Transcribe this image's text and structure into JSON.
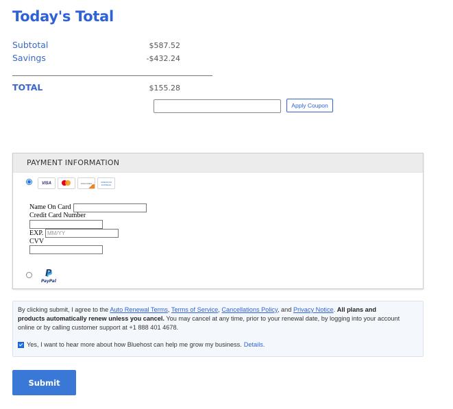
{
  "summary": {
    "title": "Today's Total",
    "subtotal_label": "Subtotal",
    "subtotal_value": "$587.52",
    "savings_label": "Savings",
    "savings_value": "-$432.24",
    "total_label": "TOTAL",
    "total_value": "$155.28"
  },
  "coupon": {
    "input_value": "",
    "input_placeholder": "",
    "apply_label": "Apply Coupon"
  },
  "payment": {
    "header": "PAYMENT INFORMATION",
    "methods": [
      {
        "id": "card",
        "selected": true,
        "icons": [
          "visa-icon",
          "mastercard-icon",
          "discover-icon",
          "american-express-icon"
        ]
      },
      {
        "id": "paypal",
        "selected": false,
        "icons": [
          "paypal-icon"
        ]
      }
    ],
    "card_labels": {
      "visa": "VISA",
      "discover": "DISCOVER",
      "amex": "AMERICAN EXPRESS",
      "paypal": "PayPal"
    },
    "fields": {
      "name_label": "Name On Card",
      "name_value": "",
      "number_label": "Credit Card Number",
      "number_value": "",
      "exp_label": "EXP.",
      "exp_placeholder": "MM/YY",
      "exp_value": "",
      "cvv_label": "CVV",
      "cvv_value": ""
    }
  },
  "terms": {
    "intro": "By clicking submit, I agree to the ",
    "links": [
      "Auto Renewal Terms",
      "Terms of Service",
      "Cancellations Policy",
      "Privacy Notice"
    ],
    "sep1": ", ",
    "sep2": ", ",
    "sep3": ", and ",
    "sep4": ". ",
    "bold": "All plans and products automatically renew unless you cancel.",
    "rest": " You may cancel at any time, prior to your renewal date, by logging into your account online or by calling customer support at +1 888 401 4678.",
    "optin_checked": true,
    "optin_text": "Yes, I want to hear more about how Bluehost can help me grow my business.",
    "optin_link": "Details."
  },
  "submit_label": "Submit",
  "colors": {
    "brand_blue": "#2f62d6",
    "button_blue": "#3a78d8"
  }
}
